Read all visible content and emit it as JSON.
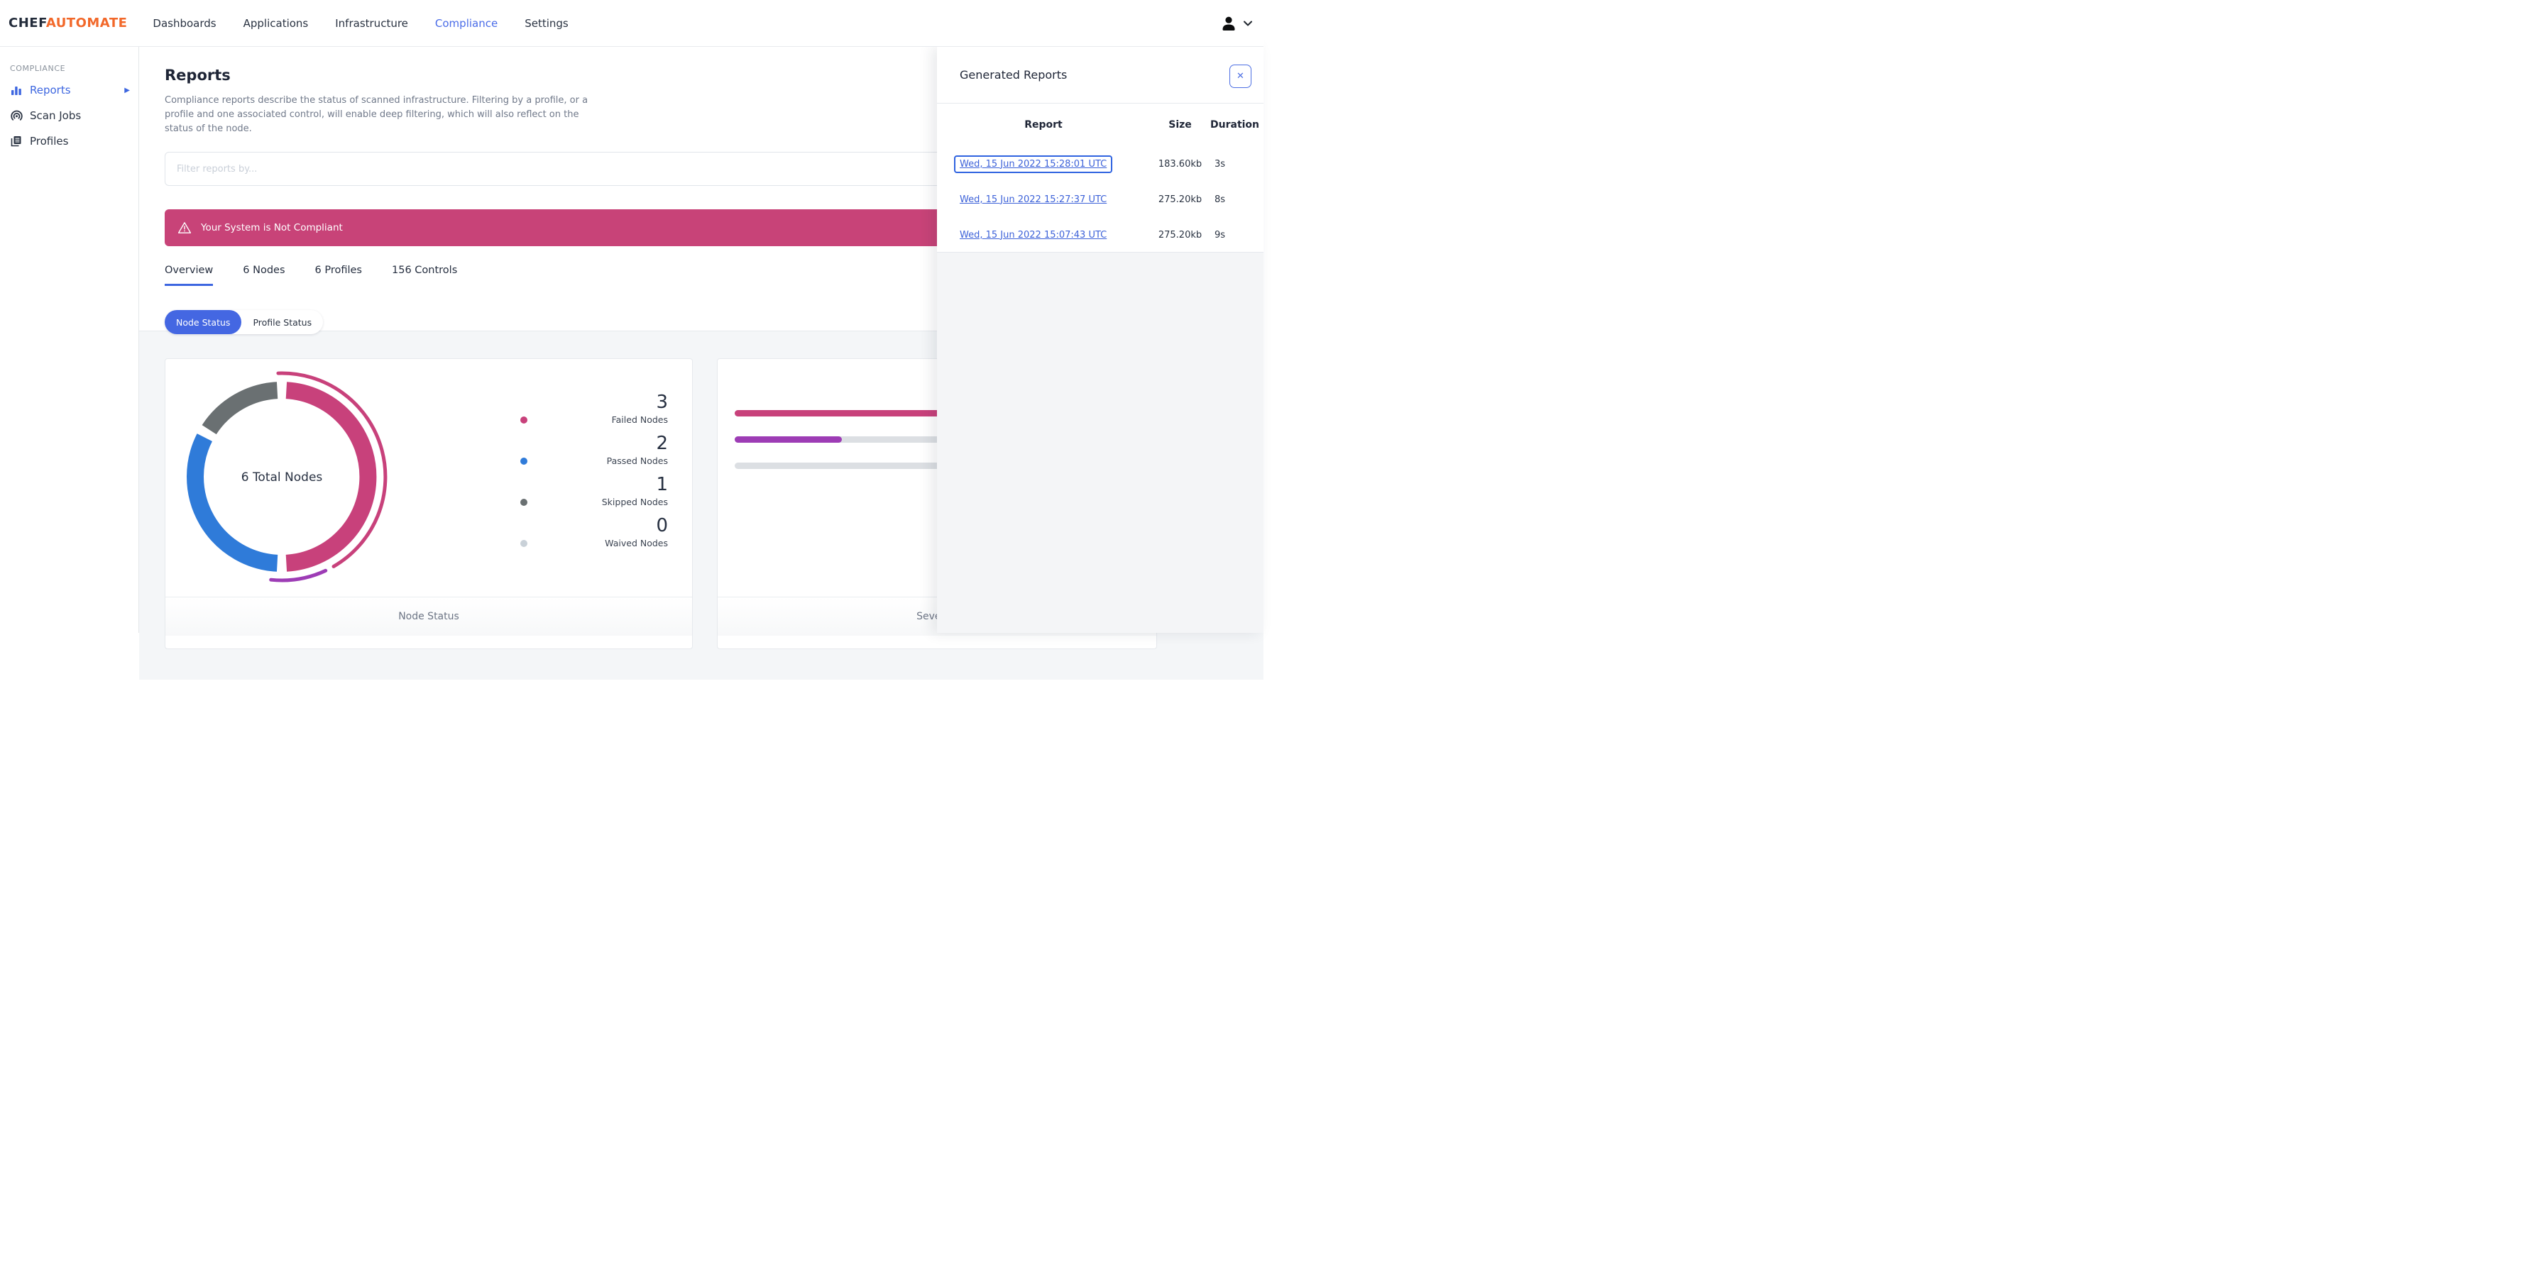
{
  "brand": {
    "chef": "CHEF",
    "automate": "AUTOMATE"
  },
  "nav": {
    "items": [
      {
        "label": "Dashboards",
        "active": false
      },
      {
        "label": "Applications",
        "active": false
      },
      {
        "label": "Infrastructure",
        "active": false
      },
      {
        "label": "Compliance",
        "active": true
      },
      {
        "label": "Settings",
        "active": false
      }
    ]
  },
  "sidebar": {
    "section": "COMPLIANCE",
    "items": [
      {
        "label": "Reports",
        "active": true,
        "icon": "bar-chart-icon"
      },
      {
        "label": "Scan Jobs",
        "active": false,
        "icon": "radar-icon"
      },
      {
        "label": "Profiles",
        "active": false,
        "icon": "documents-icon"
      }
    ]
  },
  "page": {
    "title": "Reports",
    "description": "Compliance reports describe the status of scanned infrastructure. Filtering by a profile, or a profile and one associated control, will enable deep filtering, which will also reflect on the status of the node.",
    "filter_placeholder": "Filter reports by...",
    "banner_text": "Your System is Not Compliant"
  },
  "tabs": [
    {
      "label": "Overview",
      "active": true
    },
    {
      "label": "6 Nodes",
      "active": false
    },
    {
      "label": "6 Profiles",
      "active": false
    },
    {
      "label": "156 Controls",
      "active": false
    }
  ],
  "toggles": [
    {
      "label": "Node Status",
      "active": true
    },
    {
      "label": "Profile Status",
      "active": false
    }
  ],
  "node_status_card": {
    "center_label": "6 Total Nodes",
    "footer": "Node Status",
    "legend": [
      {
        "count": "3",
        "label": "Failed Nodes",
        "color": "#c8417b"
      },
      {
        "count": "2",
        "label": "Passed Nodes",
        "color": "#2f7bd9"
      },
      {
        "count": "1",
        "label": "Skipped Nodes",
        "color": "#6a7072"
      },
      {
        "count": "0",
        "label": "Waived Nodes",
        "color": "#c9d1d8"
      }
    ]
  },
  "severity_card": {
    "footer": "Severity"
  },
  "chart_data": [
    {
      "type": "pie",
      "subtype": "donut",
      "title": "Node Status",
      "center_label": "6 Total Nodes",
      "total": 6,
      "series": [
        {
          "name": "Failed Nodes",
          "value": 3,
          "color": "#c8417b"
        },
        {
          "name": "Passed Nodes",
          "value": 2,
          "color": "#2f7bd9"
        },
        {
          "name": "Skipped Nodes",
          "value": 1,
          "color": "#6a7072"
        },
        {
          "name": "Waived Nodes",
          "value": 0,
          "color": "#c9d1d8"
        }
      ],
      "legend_position": "right"
    },
    {
      "type": "bar",
      "orientation": "horizontal",
      "title": "Severity",
      "values_percent": [
        100,
        27,
        0
      ],
      "colors": [
        "#c8417b",
        "#9d3cb5",
        "#dcdfe3"
      ]
    }
  ],
  "panel": {
    "title": "Generated Reports",
    "close_label": "✕",
    "columns": [
      "Report",
      "Size",
      "Duration"
    ],
    "rows": [
      {
        "report": "Wed, 15 Jun 2022 15:28:01 UTC",
        "size": "183.60kb",
        "duration": "3s",
        "focused": true
      },
      {
        "report": "Wed, 15 Jun 2022 15:27:37 UTC",
        "size": "275.20kb",
        "duration": "8s",
        "focused": false
      },
      {
        "report": "Wed, 15 Jun 2022 15:07:43 UTC",
        "size": "275.20kb",
        "duration": "9s",
        "focused": false
      }
    ]
  },
  "colors": {
    "accent_blue": "#3d66e0",
    "link_blue": "#3d62d9",
    "failed_pink": "#c8417b",
    "passed_blue": "#2f7bd9",
    "skipped_gray": "#6a7072",
    "waived_gray": "#c9d1d8",
    "major_purple": "#9d3cb5",
    "banner_pink": "#c84378",
    "brand_orange": "#f2682a",
    "page_bg": "#f4f6f8"
  }
}
